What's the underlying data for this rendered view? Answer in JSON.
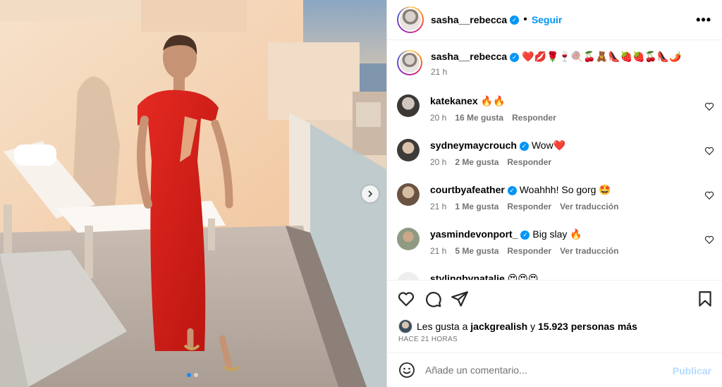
{
  "post": {
    "username": "sasha__rebecca",
    "follow_label": "Seguir",
    "separator": "•",
    "more_label": "•••",
    "caption_emojis": "❤️💋🌹🍷🍭🍒🧸👠🍓🍓🍒👠🌶️",
    "caption_time": "21 h"
  },
  "comments": [
    {
      "user": "katekanex",
      "verified": false,
      "text": "🔥🔥",
      "time": "20 h",
      "likes": "16 Me gusta",
      "reply": "Responder",
      "translate": ""
    },
    {
      "user": "sydneymaycrouch",
      "verified": true,
      "text": "Wow❤️",
      "time": "20 h",
      "likes": "2 Me gusta",
      "reply": "Responder",
      "translate": ""
    },
    {
      "user": "courtbyafeather",
      "verified": true,
      "text": "Woahhh! So gorg 🤩",
      "time": "21 h",
      "likes": "1 Me gusta",
      "reply": "Responder",
      "translate": "Ver traducción"
    },
    {
      "user": "yasmindevonport_",
      "verified": true,
      "text": "Big slay 🔥",
      "time": "21 h",
      "likes": "5 Me gusta",
      "reply": "Responder",
      "translate": "Ver traducción"
    },
    {
      "user": "stylingbynatalie",
      "verified": false,
      "text": "😍😍😍",
      "time": "",
      "likes": "",
      "reply": "",
      "translate": ""
    }
  ],
  "likes_bar": {
    "prefix": "Les gusta a",
    "liker": "jackgrealish",
    "middle": "y",
    "count": "15.923 personas más"
  },
  "timestamp": "HACE 21 HORAS",
  "add_comment": {
    "placeholder": "Añade un comentario...",
    "publish_label": "Publicar"
  },
  "carousel": {
    "slide_count": 2,
    "active_index": 0
  },
  "colors": {
    "accent": "#0095f6",
    "publish_disabled": "#b3dbff",
    "muted": "#737373",
    "dress": "#d81e1e"
  },
  "icons": {
    "like": "heart-icon",
    "comment": "comment-icon",
    "share": "send-icon",
    "save": "bookmark-icon",
    "emoji": "smiley-icon",
    "next": "chevron-right-icon"
  }
}
